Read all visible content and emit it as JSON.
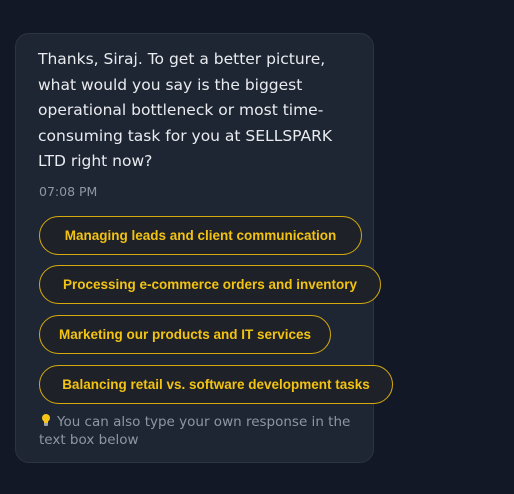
{
  "chat": {
    "message": "Thanks, Siraj. To get a better picture,\nwhat would you say is the biggest\noperational bottleneck or most time-\nconsuming task for you at SELLSPARK\nLTD right now?",
    "timestamp": "07:08 PM",
    "options": [
      {
        "label": "Managing leads and client communication"
      },
      {
        "label": "Processing e-commerce orders and inventory"
      },
      {
        "label": "Marketing our products and IT services"
      },
      {
        "label": "Balancing retail vs. software development tasks"
      }
    ],
    "hint": "You can also type your own response in the text box below",
    "hint_icon": "lightbulb-icon"
  },
  "colors": {
    "background": "#121826",
    "bubble": "#1e2633",
    "accent": "#f2c312",
    "option_border": "#d4aa0e",
    "text": "#e9ebef",
    "muted": "#8e96a3"
  }
}
